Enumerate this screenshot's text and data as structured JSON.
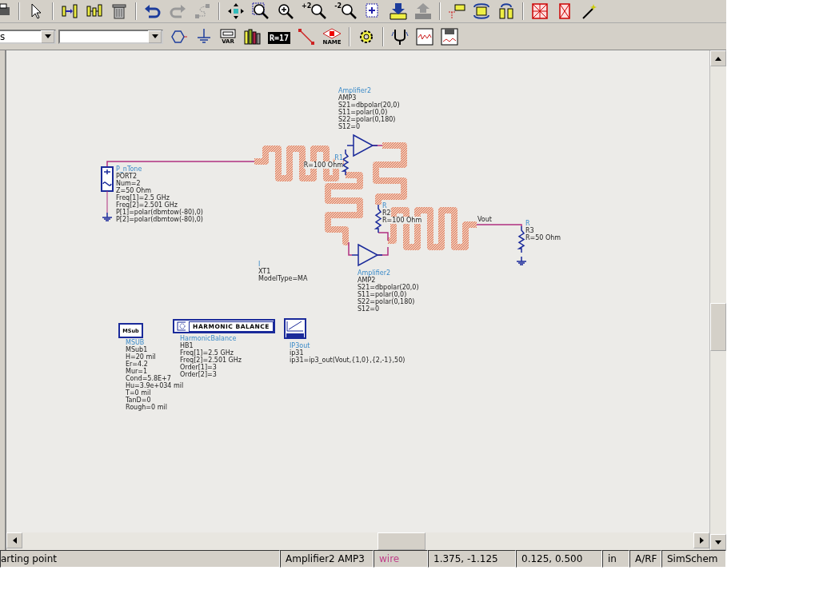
{
  "toolbar": {
    "zoom_in_step": "+2",
    "zoom_out_step": "-2"
  },
  "palette": {
    "library_value": "s",
    "var_label": "VAR",
    "equation_label": "R=17",
    "name_label": "NAME"
  },
  "schematic": {
    "components": [
      {
        "kind": "source",
        "lines": [
          "P_nTone",
          "PORT2",
          "Num=2",
          "Z=50 Ohm",
          "Freq[1]=2.5 GHz",
          "Freq[2]=2.501 GHz",
          "P[1]=polar(dbmtow(-80),0)",
          "P[2]=polar(dbmtow(-80),0)"
        ]
      },
      {
        "kind": "amplifier",
        "lines": [
          "Amplifier2",
          "AMP3",
          "S21=dbpolar(20,0)",
          "S11=polar(0,0)",
          "S22=polar(0,180)",
          "S12=0"
        ]
      },
      {
        "kind": "resistor",
        "lines": [
          "R1",
          "R=100 Ohm"
        ]
      },
      {
        "kind": "resistor",
        "lines": [
          "R",
          "R2",
          "R=100 Ohm"
        ]
      },
      {
        "kind": "resistor",
        "lines": [
          "R",
          "R3",
          "R=50 Ohm"
        ]
      },
      {
        "kind": "amplifier",
        "lines": [
          "Amplifier2",
          "AMP2",
          "S21=dbpolar(20,0)",
          "S11=polar(0,0)",
          "S22=polar(0,180)",
          "S12=0"
        ]
      },
      {
        "kind": "model",
        "lines": [
          "I",
          "XT1",
          "ModelType=MA"
        ]
      },
      {
        "kind": "msub",
        "box_text": "MSub",
        "lines": [
          "MSUB",
          "MSub1",
          "H=20 mil",
          "Er=4.2",
          "Mur=1",
          "Cond=5.8E+7",
          "Hu=3.9e+034 mil",
          "T=0 mil",
          "TanD=0",
          "Rough=0 mil"
        ]
      },
      {
        "kind": "hb",
        "box_text": "HARMONIC BALANCE",
        "lines": [
          "HarmonicBalance",
          "HB1",
          "Freq[1]=2.5 GHz",
          "Freq[2]=2.501 GHz",
          "Order[1]=3",
          "Order[2]=3"
        ]
      },
      {
        "kind": "ip3",
        "lines": [
          "IP3out",
          "ip31",
          "ip31=ip3_out(Vout,{1,0},{2,-1},50)"
        ]
      }
    ],
    "wire_labels": [
      "Vout"
    ]
  },
  "status_bar": [
    {
      "kind": "prompt",
      "text": "arting point"
    },
    {
      "kind": "info",
      "text": "Amplifier2 AMP3"
    },
    {
      "kind": "mode",
      "text": "wire"
    },
    {
      "kind": "info",
      "text": "1.375, -1.125"
    },
    {
      "kind": "info",
      "text": "0.125, 0.500"
    },
    {
      "kind": "info",
      "text": "in"
    },
    {
      "kind": "info",
      "text": "A/RF"
    },
    {
      "kind": "info",
      "text": "SimSchem"
    }
  ]
}
